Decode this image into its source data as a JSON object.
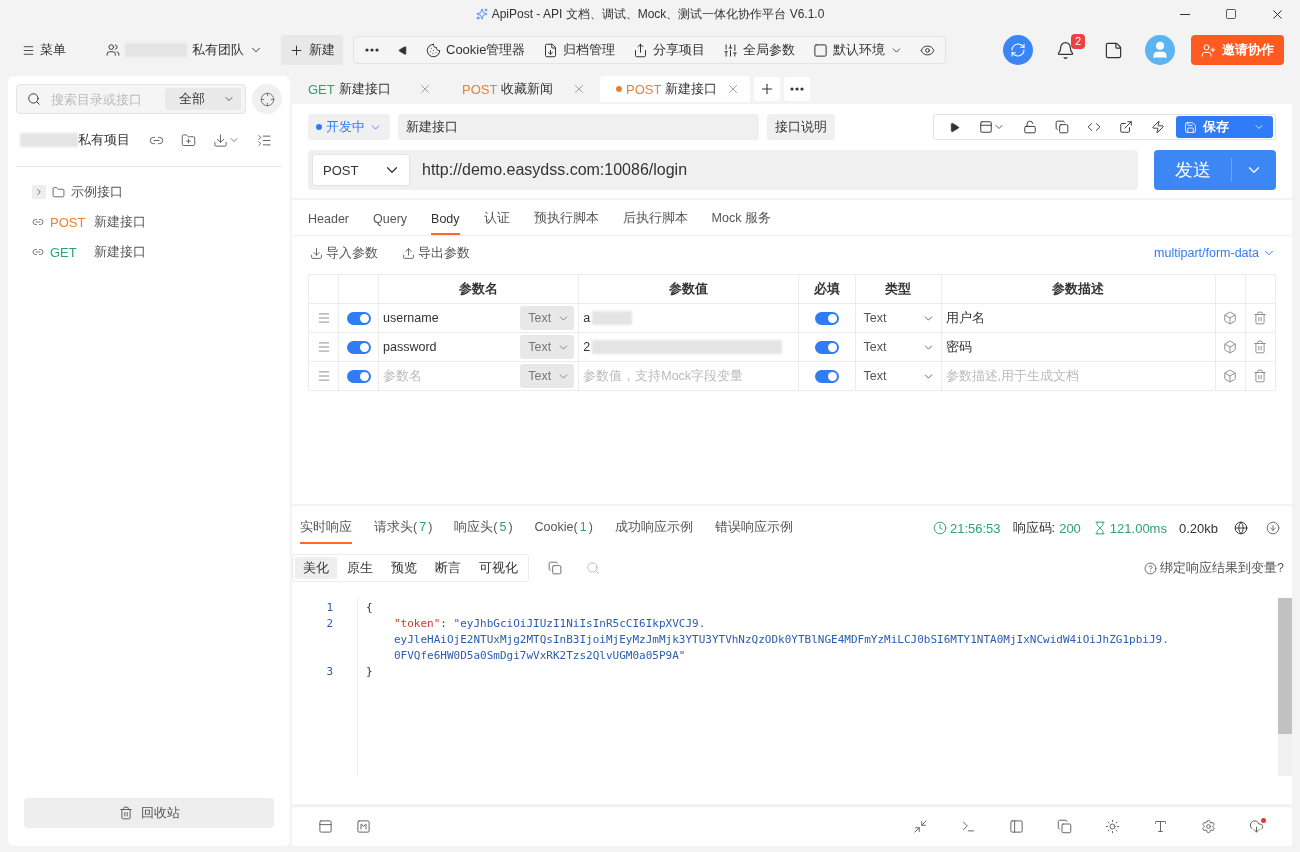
{
  "window": {
    "title": "ApiPost - API 文档、调试、Mock、测试一体化协作平台 V6.1.0"
  },
  "toolbar": {
    "menu": "菜单",
    "team": "私有团队",
    "new": "新建",
    "items": [
      {
        "kind": "more"
      },
      {
        "kind": "back"
      },
      {
        "kind": "cookie",
        "label": "Cookie管理器"
      },
      {
        "kind": "archive",
        "label": "归档管理"
      },
      {
        "kind": "share",
        "label": "分享项目"
      },
      {
        "kind": "params",
        "label": "全局参数"
      },
      {
        "kind": "env",
        "label": "默认环境"
      },
      {
        "kind": "eye"
      }
    ],
    "notifications": "2",
    "invite": "邀请协作"
  },
  "sidebar": {
    "search": {
      "placeholder": "搜索目录或接口",
      "scope": "全部"
    },
    "project": "私有项目",
    "tree": [
      {
        "kind": "folder",
        "name": "示例接口",
        "expanded": false
      },
      {
        "kind": "api",
        "method": "POST",
        "color": "#e8822f",
        "name": "新建接口"
      },
      {
        "kind": "api",
        "method": "GET",
        "color": "#2ba36f",
        "name": "新建接口"
      }
    ],
    "trash": "回收站"
  },
  "tabs": [
    {
      "method": "GET",
      "color": "#2ba36f",
      "name": "新建接口",
      "selected": false,
      "modified": false
    },
    {
      "method": "POST",
      "color": "#e8822f",
      "name": "收藏新闻",
      "selected": false,
      "modified": false
    },
    {
      "method": "POST",
      "color": "#e8822f",
      "name": "新建接口",
      "selected": true,
      "modified": true
    }
  ],
  "request": {
    "status": "开发中",
    "name": "新建接口",
    "doc": "接口说明",
    "save": "保存",
    "method": "POST",
    "url": "http://demo.easydss.com:10086/login",
    "send": "发送"
  },
  "param_tabs": [
    {
      "label": "Header",
      "selected": false
    },
    {
      "label": "Query",
      "selected": false
    },
    {
      "label": "Body",
      "selected": true
    },
    {
      "label": "认证",
      "selected": false
    },
    {
      "label": "预执行脚本",
      "selected": false
    },
    {
      "label": "后执行脚本",
      "selected": false
    },
    {
      "label": "Mock 服务",
      "selected": false
    }
  ],
  "import": "导入参数",
  "export": "导出参数",
  "body_type": "multipart/form-data",
  "table": {
    "columns": [
      "参数名",
      "参数值",
      "必填",
      "类型",
      "参数描述"
    ],
    "rows": [
      {
        "enabled": true,
        "name": "username",
        "field_type": "Text",
        "value": "a",
        "required": true,
        "type": "Text",
        "desc": "用户名"
      },
      {
        "enabled": true,
        "name": "password",
        "field_type": "Text",
        "value": "2",
        "required": true,
        "type": "Text",
        "desc": "密码"
      },
      {
        "enabled": true,
        "name_placeholder": "参数名",
        "field_type": "Text",
        "value_placeholder": "参数值，支持Mock字段变量",
        "required": true,
        "type": "Text",
        "desc_placeholder": "参数描述,用于生成文档"
      }
    ]
  },
  "response": {
    "tabs": [
      {
        "label": "实时响应",
        "selected": true
      },
      {
        "label": "请求头",
        "open": "(",
        "count": "7",
        "close": ")",
        "selected": false
      },
      {
        "label": "响应头",
        "open": "(",
        "count": "5",
        "close": ")",
        "selected": false
      },
      {
        "label": "Cookie",
        "open": "(",
        "count": "1",
        "close": ")",
        "selected": false
      },
      {
        "label": "成功响应示例",
        "selected": false
      },
      {
        "label": "错误响应示例",
        "selected": false
      }
    ],
    "time": "21:56:53",
    "code_label": "响应码:",
    "code": "200",
    "duration": "121.00ms",
    "size": "0.20kb",
    "views": [
      {
        "label": "美化",
        "selected": true
      },
      {
        "label": "原生",
        "selected": false
      },
      {
        "label": "预览",
        "selected": false
      },
      {
        "label": "断言",
        "selected": false
      },
      {
        "label": "可视化",
        "selected": false
      }
    ],
    "bind": "绑定响应结果到变量?",
    "lines": [
      {
        "number": "1",
        "text": "{"
      },
      {
        "number": "2",
        "key": "\"token\"",
        "colon": ": ",
        "value_lines": [
          "\"eyJhbGciOiJIUzI1NiIsInR5cCI6IkpXVCJ9.",
          "eyJleHAiOjE2NTUxMjg2MTQsInB3IjoiMjEyMzJmMjk3YTU3YTVhNzQzODk0YTBlNGE4MDFmYzMiLCJ0bSI6MTY1NTA0MjIxNCwidW4iOiJhZG1pbiJ9.",
          "0FVQfe6HW0D5a0SmDgi7wVxRK2Tzs2QlvUGM0a05P9A\""
        ]
      },
      {
        "number": "3",
        "text": "}"
      }
    ]
  }
}
